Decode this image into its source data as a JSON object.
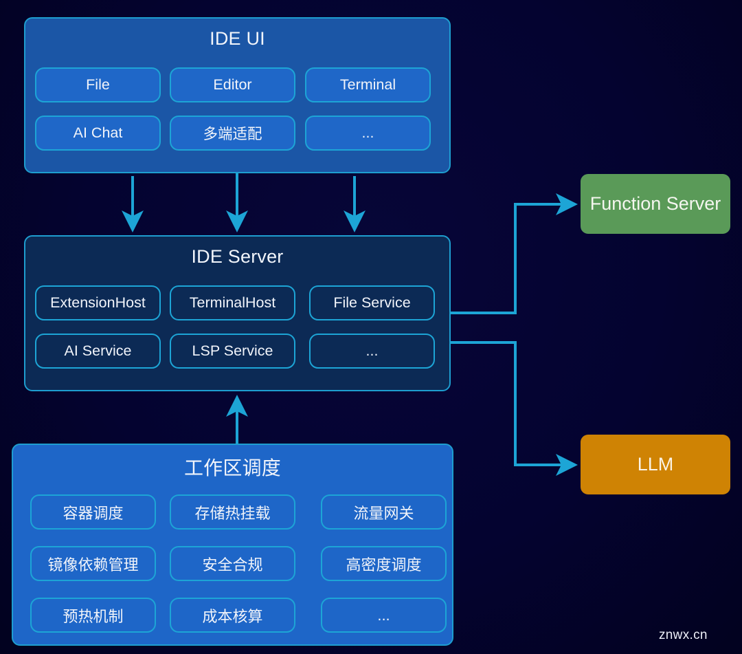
{
  "ide_ui": {
    "title": "IDE UI",
    "items": [
      "File",
      "Editor",
      "Terminal",
      "AI Chat",
      "多端适配",
      "..."
    ]
  },
  "ide_server": {
    "title": "IDE Server",
    "items": [
      "ExtensionHost",
      "TerminalHost",
      "File Service",
      "AI Service",
      "LSP Service",
      "..."
    ]
  },
  "workspace_scheduling": {
    "title": "工作区调度",
    "items": [
      "容器调度",
      "存储热挂载",
      "流量网关",
      "镜像依赖管理",
      "安全合规",
      "高密度调度",
      "预热机制",
      "成本核算",
      "..."
    ]
  },
  "external": {
    "function_server": {
      "label": "Function Server",
      "color": "#5a9a58"
    },
    "llm": {
      "label": "LLM",
      "color": "#cf8304"
    }
  },
  "connections": [
    {
      "from": "ide_ui",
      "to": "ide_server"
    },
    {
      "from": "workspace_scheduling",
      "to": "ide_server"
    },
    {
      "from": "ide_server",
      "to": "function_server"
    },
    {
      "from": "ide_server",
      "to": "llm"
    }
  ],
  "colors": {
    "connector": "#1da5d6",
    "background": "#03022a"
  },
  "watermark": "znwx.cn"
}
